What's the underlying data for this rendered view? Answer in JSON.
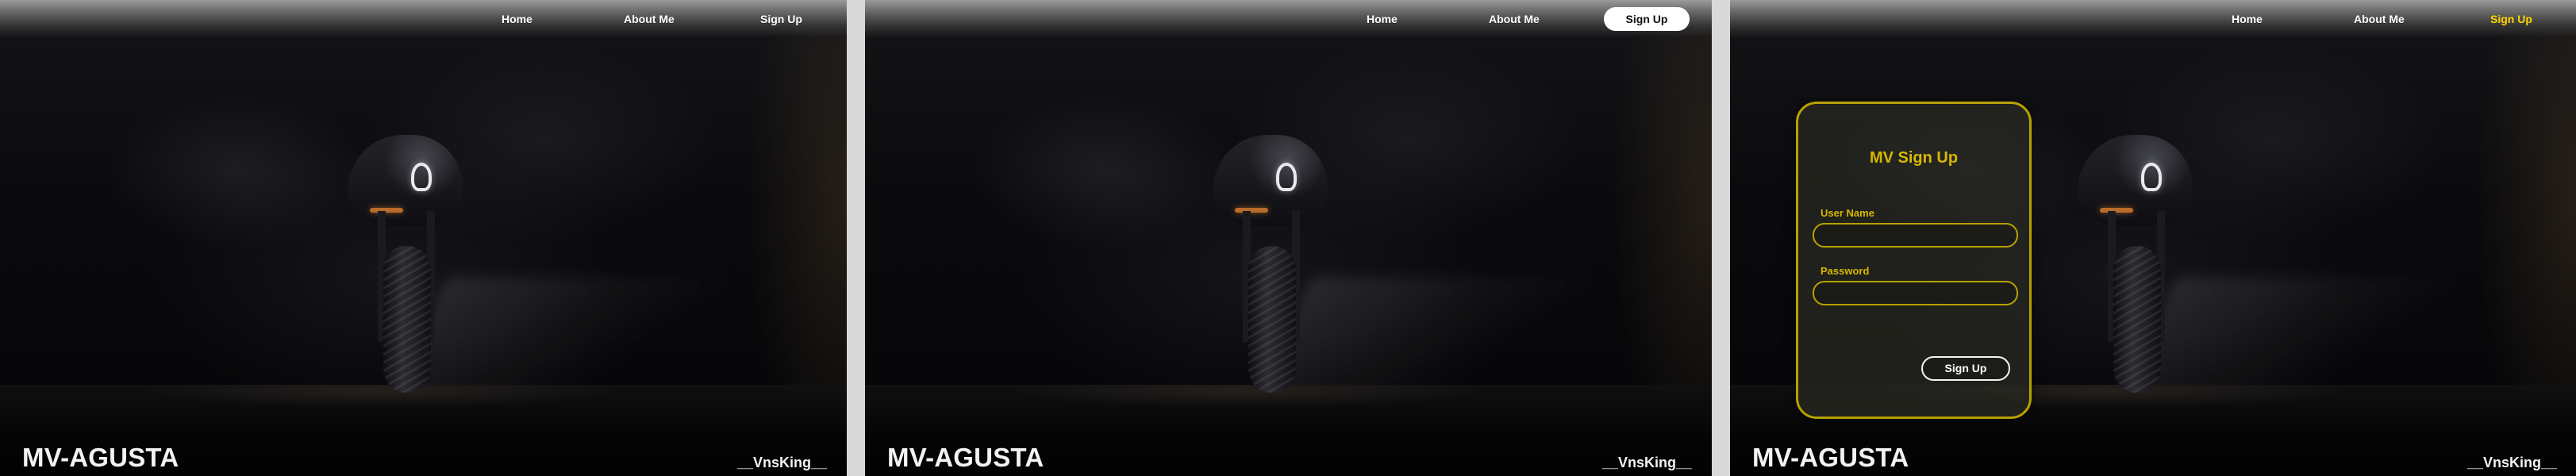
{
  "nav": {
    "home": "Home",
    "about": "About Me",
    "signup": "Sign Up"
  },
  "brand": {
    "title": "MV-AGUSTA",
    "author": "__VnsKing__"
  },
  "signup_card": {
    "title": "MV Sign Up",
    "username_label": "User Name",
    "username_value": "",
    "password_label": "Password",
    "password_value": "",
    "submit_label": "Sign Up"
  },
  "colors": {
    "accent_gold": "#d7b800",
    "card_border": "#b8a100",
    "text_white": "#ffffff"
  },
  "icons": {
    "motorcycle": "motorcycle-image"
  }
}
